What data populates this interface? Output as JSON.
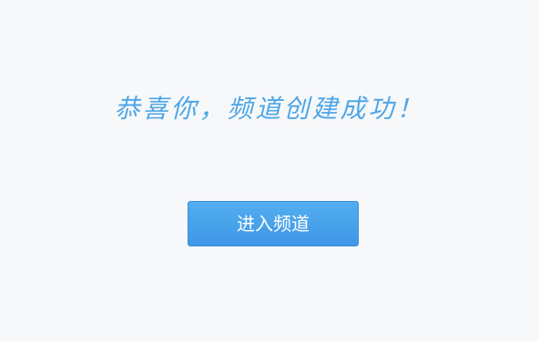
{
  "message": {
    "headline": "恭喜你，频道创建成功！"
  },
  "actions": {
    "enter_channel_label": "进入频道"
  },
  "colors": {
    "background": "#f7f8fa",
    "headline": "#4ea6e6",
    "button": "#4aa3eb",
    "button_text": "#ffffff"
  }
}
